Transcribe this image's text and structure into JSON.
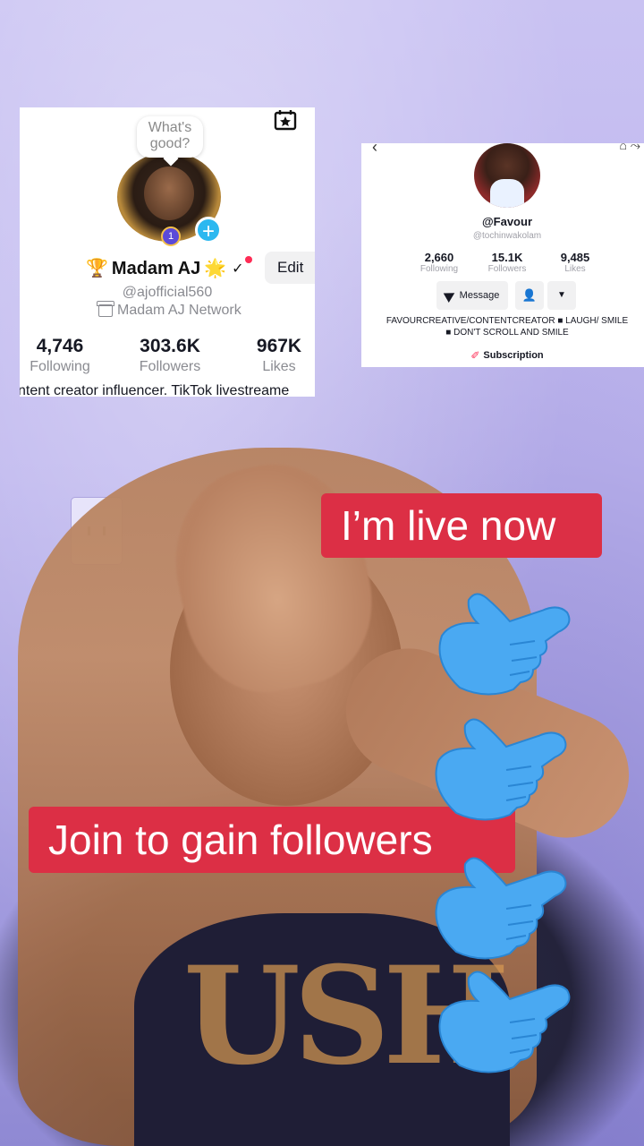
{
  "profile_card_a": {
    "bubble_text": "What's good?",
    "level": "1",
    "name": "Madam AJ",
    "handle": "@ajofficial560",
    "network": "Madam AJ Network",
    "edit_label": "Edit",
    "stats": [
      {
        "value": "4,746",
        "label": "Following"
      },
      {
        "value": "303.6K",
        "label": "Followers"
      },
      {
        "value": "967K",
        "label": "Likes"
      }
    ],
    "bio_fragment": "ntent creator influencer. TikTok livestreame"
  },
  "profile_card_b": {
    "name": "@Favour",
    "handle": "@tochinwakolam",
    "stats": [
      {
        "value": "2,660",
        "label": "Following"
      },
      {
        "value": "15.1K",
        "label": "Followers"
      },
      {
        "value": "9,485",
        "label": "Likes"
      }
    ],
    "message_label": "Message",
    "bio": "FAVOURCREATIVE/CONTENTCREATOR ■ LAUGH/ SMILE ■ DON'T SCROLL AND SMILE",
    "subscription_label": "Subscription"
  },
  "captions": {
    "live": "I’m live now",
    "join": "Join to gain followers"
  },
  "colors": {
    "caption_bg": "#dc2f45",
    "hand_emoji": "#4aa9f2",
    "plus_button": "#2cb8f0",
    "tiktok_red": "#fe2c55"
  },
  "icons": [
    "calendar-star-icon",
    "trophy-icon",
    "sparkle-star-icon",
    "chevron-down-icon",
    "store-icon",
    "send-icon",
    "add-friend-icon",
    "caret-down-icon",
    "subscription-icon",
    "pointing-right-hand-icon"
  ]
}
